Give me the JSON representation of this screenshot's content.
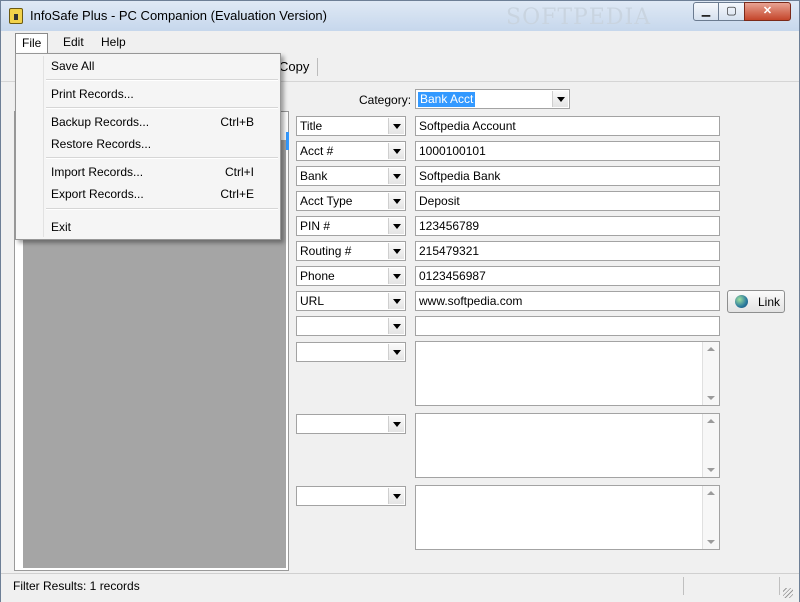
{
  "window": {
    "title": "InfoSafe Plus - PC Companion (Evaluation Version)",
    "watermark": "SOFTPEDIA",
    "buttons": {
      "minimize": "▁",
      "maximize": "▢",
      "close": "✕"
    }
  },
  "menubar": {
    "items": [
      "File",
      "Edit",
      "Help"
    ]
  },
  "toolbar": {
    "copy_label": "Copy"
  },
  "file_menu": {
    "items": [
      {
        "label": "Save All",
        "shortcut": ""
      },
      {
        "label": "Print Records...",
        "shortcut": ""
      },
      {
        "label": "Backup Records...",
        "shortcut": "Ctrl+B"
      },
      {
        "label": "Restore Records...",
        "shortcut": ""
      },
      {
        "label": "Import Records...",
        "shortcut": "Ctrl+I"
      },
      {
        "label": "Export Records...",
        "shortcut": "Ctrl+E"
      },
      {
        "label": "Exit",
        "shortcut": ""
      }
    ]
  },
  "form": {
    "category_label": "Category:",
    "category_value": "Bank Acct",
    "fields": [
      {
        "label": "Title",
        "value": "Softpedia Account"
      },
      {
        "label": "Acct #",
        "value": "1000100101"
      },
      {
        "label": "Bank",
        "value": "Softpedia Bank"
      },
      {
        "label": "Acct Type",
        "value": "Deposit"
      },
      {
        "label": "PIN #",
        "value": "123456789"
      },
      {
        "label": "Routing #",
        "value": "215479321"
      },
      {
        "label": "Phone",
        "value": "0123456987"
      },
      {
        "label": "URL",
        "value": "www.softpedia.com"
      },
      {
        "label": "",
        "value": ""
      }
    ],
    "memos": [
      {
        "label": "",
        "value": ""
      },
      {
        "label": "",
        "value": ""
      },
      {
        "label": "",
        "value": ""
      }
    ],
    "link_button_label": "Link"
  },
  "status": {
    "text": "Filter Results: 1 records"
  },
  "icons": [
    "app-lock-icon",
    "globe-icon",
    "dropdown-arrow-icon",
    "resize-grip-icon"
  ]
}
